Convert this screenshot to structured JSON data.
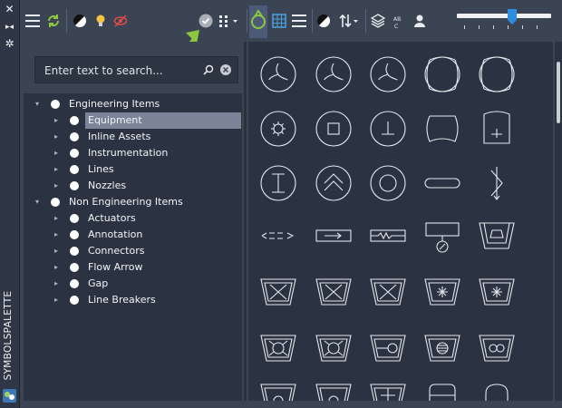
{
  "palette_title": "SYMBOLSPALETTE",
  "search": {
    "placeholder": "Enter text to search..."
  },
  "tree": [
    {
      "label": "Engineering Items",
      "level": 0,
      "expanded": true
    },
    {
      "label": "Equipment",
      "level": 1,
      "selected": true
    },
    {
      "label": "Inline Assets",
      "level": 1
    },
    {
      "label": "Instrumentation",
      "level": 1
    },
    {
      "label": "Lines",
      "level": 1
    },
    {
      "label": "Nozzles",
      "level": 1
    },
    {
      "label": "Non Engineering Items",
      "level": 0,
      "expanded": true
    },
    {
      "label": "Actuators",
      "level": 1
    },
    {
      "label": "Annotation",
      "level": 1
    },
    {
      "label": "Connectors",
      "level": 1
    },
    {
      "label": "Flow Arrow",
      "level": 1
    },
    {
      "label": "Gap",
      "level": 1
    },
    {
      "label": "Line Breakers",
      "level": 1
    }
  ],
  "colors": {
    "accent_green": "#8dc63f",
    "selection": "#7c8497",
    "active_tool": "#4a5a78"
  },
  "icons": [
    "close-icon",
    "dock-icon",
    "settings-icon",
    "menu-icon",
    "refresh-icon",
    "contrast-icon",
    "lightbulb-icon",
    "visibility-off-icon",
    "checkmark-icon",
    "grid-dropdown-icon",
    "tree-icon",
    "table-view-icon",
    "list-view-icon",
    "sort-icon",
    "layers-icon",
    "text-abc-icon",
    "user-icon"
  ],
  "slider_value": 0.59
}
